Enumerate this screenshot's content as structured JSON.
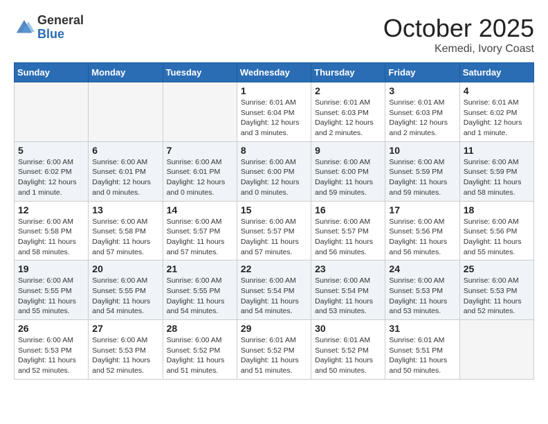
{
  "header": {
    "logo_general": "General",
    "logo_blue": "Blue",
    "month": "October 2025",
    "location": "Kemedi, Ivory Coast"
  },
  "days_of_week": [
    "Sunday",
    "Monday",
    "Tuesday",
    "Wednesday",
    "Thursday",
    "Friday",
    "Saturday"
  ],
  "weeks": [
    [
      {
        "day": "",
        "info": ""
      },
      {
        "day": "",
        "info": ""
      },
      {
        "day": "",
        "info": ""
      },
      {
        "day": "1",
        "info": "Sunrise: 6:01 AM\nSunset: 6:04 PM\nDaylight: 12 hours and 3 minutes."
      },
      {
        "day": "2",
        "info": "Sunrise: 6:01 AM\nSunset: 6:03 PM\nDaylight: 12 hours and 2 minutes."
      },
      {
        "day": "3",
        "info": "Sunrise: 6:01 AM\nSunset: 6:03 PM\nDaylight: 12 hours and 2 minutes."
      },
      {
        "day": "4",
        "info": "Sunrise: 6:01 AM\nSunset: 6:02 PM\nDaylight: 12 hours and 1 minute."
      }
    ],
    [
      {
        "day": "5",
        "info": "Sunrise: 6:00 AM\nSunset: 6:02 PM\nDaylight: 12 hours and 1 minute."
      },
      {
        "day": "6",
        "info": "Sunrise: 6:00 AM\nSunset: 6:01 PM\nDaylight: 12 hours and 0 minutes."
      },
      {
        "day": "7",
        "info": "Sunrise: 6:00 AM\nSunset: 6:01 PM\nDaylight: 12 hours and 0 minutes."
      },
      {
        "day": "8",
        "info": "Sunrise: 6:00 AM\nSunset: 6:00 PM\nDaylight: 12 hours and 0 minutes."
      },
      {
        "day": "9",
        "info": "Sunrise: 6:00 AM\nSunset: 6:00 PM\nDaylight: 11 hours and 59 minutes."
      },
      {
        "day": "10",
        "info": "Sunrise: 6:00 AM\nSunset: 5:59 PM\nDaylight: 11 hours and 59 minutes."
      },
      {
        "day": "11",
        "info": "Sunrise: 6:00 AM\nSunset: 5:59 PM\nDaylight: 11 hours and 58 minutes."
      }
    ],
    [
      {
        "day": "12",
        "info": "Sunrise: 6:00 AM\nSunset: 5:58 PM\nDaylight: 11 hours and 58 minutes."
      },
      {
        "day": "13",
        "info": "Sunrise: 6:00 AM\nSunset: 5:58 PM\nDaylight: 11 hours and 57 minutes."
      },
      {
        "day": "14",
        "info": "Sunrise: 6:00 AM\nSunset: 5:57 PM\nDaylight: 11 hours and 57 minutes."
      },
      {
        "day": "15",
        "info": "Sunrise: 6:00 AM\nSunset: 5:57 PM\nDaylight: 11 hours and 57 minutes."
      },
      {
        "day": "16",
        "info": "Sunrise: 6:00 AM\nSunset: 5:57 PM\nDaylight: 11 hours and 56 minutes."
      },
      {
        "day": "17",
        "info": "Sunrise: 6:00 AM\nSunset: 5:56 PM\nDaylight: 11 hours and 56 minutes."
      },
      {
        "day": "18",
        "info": "Sunrise: 6:00 AM\nSunset: 5:56 PM\nDaylight: 11 hours and 55 minutes."
      }
    ],
    [
      {
        "day": "19",
        "info": "Sunrise: 6:00 AM\nSunset: 5:55 PM\nDaylight: 11 hours and 55 minutes."
      },
      {
        "day": "20",
        "info": "Sunrise: 6:00 AM\nSunset: 5:55 PM\nDaylight: 11 hours and 54 minutes."
      },
      {
        "day": "21",
        "info": "Sunrise: 6:00 AM\nSunset: 5:55 PM\nDaylight: 11 hours and 54 minutes."
      },
      {
        "day": "22",
        "info": "Sunrise: 6:00 AM\nSunset: 5:54 PM\nDaylight: 11 hours and 54 minutes."
      },
      {
        "day": "23",
        "info": "Sunrise: 6:00 AM\nSunset: 5:54 PM\nDaylight: 11 hours and 53 minutes."
      },
      {
        "day": "24",
        "info": "Sunrise: 6:00 AM\nSunset: 5:53 PM\nDaylight: 11 hours and 53 minutes."
      },
      {
        "day": "25",
        "info": "Sunrise: 6:00 AM\nSunset: 5:53 PM\nDaylight: 11 hours and 52 minutes."
      }
    ],
    [
      {
        "day": "26",
        "info": "Sunrise: 6:00 AM\nSunset: 5:53 PM\nDaylight: 11 hours and 52 minutes."
      },
      {
        "day": "27",
        "info": "Sunrise: 6:00 AM\nSunset: 5:53 PM\nDaylight: 11 hours and 52 minutes."
      },
      {
        "day": "28",
        "info": "Sunrise: 6:00 AM\nSunset: 5:52 PM\nDaylight: 11 hours and 51 minutes."
      },
      {
        "day": "29",
        "info": "Sunrise: 6:01 AM\nSunset: 5:52 PM\nDaylight: 11 hours and 51 minutes."
      },
      {
        "day": "30",
        "info": "Sunrise: 6:01 AM\nSunset: 5:52 PM\nDaylight: 11 hours and 50 minutes."
      },
      {
        "day": "31",
        "info": "Sunrise: 6:01 AM\nSunset: 5:51 PM\nDaylight: 11 hours and 50 minutes."
      },
      {
        "day": "",
        "info": ""
      }
    ]
  ]
}
